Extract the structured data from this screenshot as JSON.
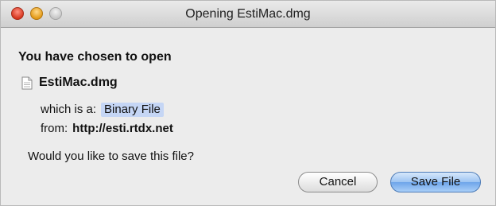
{
  "window": {
    "title": "Opening EstiMac.dmg"
  },
  "dialog": {
    "heading": "You have chosen to open",
    "file_name": "EstiMac.dmg",
    "type_label": "which is a:",
    "type_value": "Binary File",
    "from_label": "from:",
    "from_value": "http://esti.rtdx.net",
    "question": "Would you like to save this file?"
  },
  "buttons": {
    "cancel": "Cancel",
    "save": "Save File"
  },
  "icons": {
    "file": "document-icon",
    "close": "close-icon",
    "minimize": "minimize-icon",
    "zoom": "zoom-icon"
  }
}
